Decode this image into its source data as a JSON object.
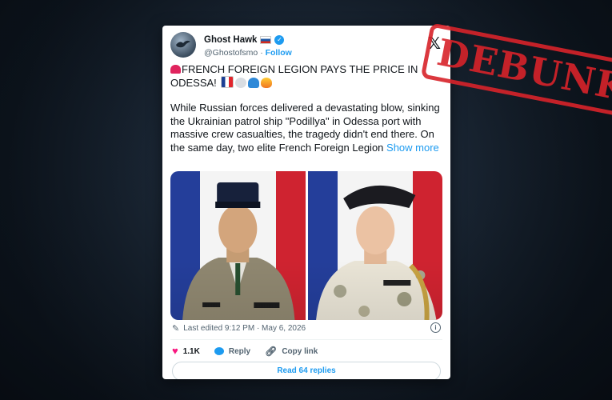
{
  "tweet": {
    "display_name": "Ghost Hawk",
    "handle": "@Ghostofsmo",
    "separator": "·",
    "follow_label": "Follow",
    "headline": "FRENCH FOREIGN LEGION PAYS THE PRICE IN ODESSA!",
    "body": "While Russian forces delivered a devastating blow, sinking the Ukrainian patrol ship \"Podillya\" in Odessa port with massive crew casualties, the tragedy didn't end there. On the same day, two elite French Foreign Legion",
    "show_more": "Show more",
    "last_edited": "Last edited 9:12 PM · May 6, 2026",
    "likes": "1.1K",
    "reply_label": "Reply",
    "copy_link_label": "Copy link",
    "read_replies": "Read 64 replies"
  },
  "stamp": {
    "text": "DEBUNKED"
  },
  "icons": {
    "verified": "verified-badge-icon",
    "platform": "x-logo-icon",
    "edit": "pencil-icon",
    "info": "info-icon",
    "like": "heart-icon",
    "reply": "reply-icon",
    "link": "link-icon"
  },
  "colors": {
    "accent": "#1d9bf0",
    "like": "#f91880",
    "stamp": "#d8232a",
    "background": "#14202e"
  }
}
